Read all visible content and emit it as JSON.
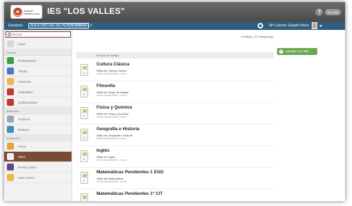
{
  "header": {
    "site_title": "IES \"LOS VALLES\"",
    "logo_line1": "Junta de",
    "logo_line2": "Castilla y León",
    "user_label": "iale vale",
    "colors": {
      "bar": "#4f4f4f",
      "nav": "#2f5d7c",
      "accent": "#7a4a32",
      "add": "#6aa84f"
    }
  },
  "nav": {
    "home": "Escritorio",
    "aula": "AULA VIRTUAL DE PENDIENTES ▸",
    "pendientes": "PENDIENTES",
    "user": "Mª Carmen Giraldo Pérez"
  },
  "sidebar": {
    "search_placeholder": "Buscar",
    "items": [
      {
        "label": "Inicio",
        "icon": "home-icon",
        "type": "item"
      },
      {
        "label": "General",
        "type": "section"
      },
      {
        "label": "Presentación",
        "icon": "presentation-icon",
        "type": "item"
      },
      {
        "label": "Temas",
        "icon": "topics-icon",
        "type": "item"
      },
      {
        "label": "Anuncios",
        "icon": "announcements-icon",
        "type": "item"
      },
      {
        "label": "Calendario",
        "icon": "calendar-icon",
        "type": "item"
      },
      {
        "label": "Calificaciones",
        "icon": "grades-icon",
        "type": "item"
      },
      {
        "label": "Materiales",
        "type": "section"
      },
      {
        "label": "Archivos",
        "icon": "files-icon",
        "type": "item"
      },
      {
        "label": "Enlaces",
        "icon": "links-icon",
        "type": "item"
      },
      {
        "label": "Interacción",
        "type": "section"
      },
      {
        "label": "Foros",
        "icon": "forums-icon",
        "type": "item"
      },
      {
        "label": "Wikis",
        "icon": "wikis-icon",
        "type": "item",
        "active": true
      },
      {
        "label": "Enviar correo",
        "icon": "send-mail-icon",
        "type": "item"
      },
      {
        "label": "Leer correo",
        "icon": "read-mail-icon",
        "type": "item"
      }
    ]
  },
  "main": {
    "stats": "8 Wiki(s) / 11 Categoría(s)",
    "group_header": "Grupos de trabajo",
    "add_label": "Agregar una wiki",
    "wikis": [
      {
        "title": "Cultura Clásica",
        "desc": "Wikis de Cultura Clásica",
        "date": "última actualización: nunca",
        "count": "0"
      },
      {
        "title": "Filosofía",
        "desc": "Wikis de Grupo de trabajo",
        "date": "última actualización: nunca",
        "count": "0"
      },
      {
        "title": "Física y Química",
        "desc": "Wikis de Física y Química",
        "date": "última actualización: nunca",
        "count": "0"
      },
      {
        "title": "Geografía e Historia",
        "desc": "Wikis de Geografía e Historia",
        "date": "última actualización: nunca",
        "count": "0"
      },
      {
        "title": "Inglés",
        "desc": "Wikis de Inglés",
        "date": "última actualización: nunca",
        "count": "0"
      },
      {
        "title": "Matemáticas Pendientes 1 ESO",
        "desc": "Wikis de Matemáticas",
        "date": "última actualización: nunca",
        "count": "0"
      },
      {
        "title": "Matemáticas Pendientes 1º CIT",
        "desc": "",
        "date": "",
        "count": ""
      }
    ]
  }
}
